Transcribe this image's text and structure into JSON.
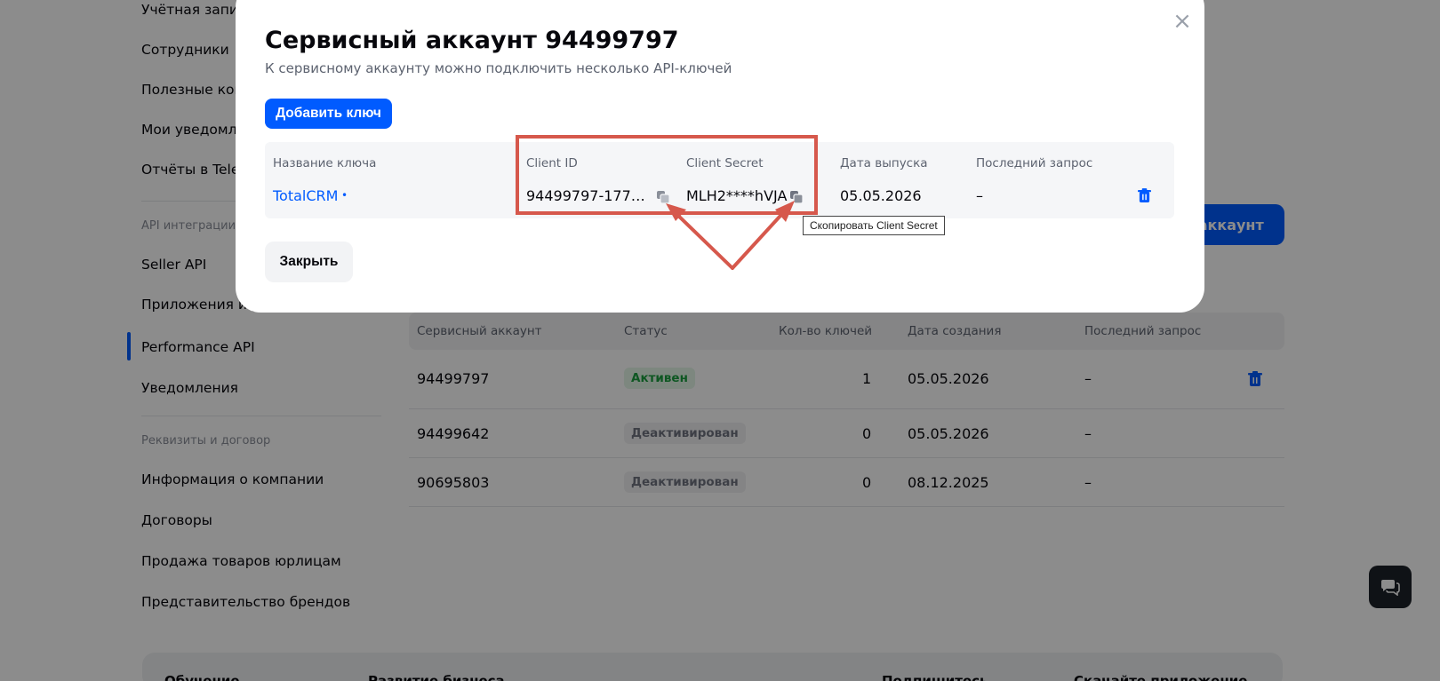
{
  "sidebar": {
    "items": [
      {
        "label": "Учётная запис"
      },
      {
        "label": "Сотрудники"
      },
      {
        "label": "Полезные кон"
      },
      {
        "label": "Мои уведомле"
      },
      {
        "label": "Отчёты в Teleg"
      }
    ],
    "api_section": "API интеграции",
    "api_items": [
      {
        "label": "Seller API"
      },
      {
        "label": "Приложения и р"
      },
      {
        "label": "Performance API",
        "active": true
      },
      {
        "label": "Уведомления"
      }
    ],
    "requisites_section": "Реквизиты и договор",
    "requisites_items": [
      {
        "label": "Информация о компании"
      },
      {
        "label": "Договоры"
      },
      {
        "label": "Продажа товаров юрлицам"
      },
      {
        "label": "Представительство брендов"
      }
    ]
  },
  "background": {
    "create_button": "ь аккаунт",
    "table": {
      "headers": [
        "Сервисный аккаунт",
        "Статус",
        "Кол-во ключей",
        "Дата создания",
        "Последний запрос"
      ],
      "rows": [
        {
          "account": "94499797",
          "status": "Активен",
          "keys": "1",
          "created": "05.05.2026",
          "last": "–"
        },
        {
          "account": "94499642",
          "status": "Деактивирован",
          "keys": "0",
          "created": "05.05.2026",
          "last": "–"
        },
        {
          "account": "90695803",
          "status": "Деактивирован",
          "keys": "0",
          "created": "08.12.2025",
          "last": "–"
        }
      ]
    },
    "footer": [
      "Обучение",
      "Развитие бизнеса",
      "Подпишитесь",
      "Скачайте приложение"
    ]
  },
  "modal": {
    "title": "Сервисный аккаунт 94499797",
    "subtitle": "К сервисному аккаунту можно подключить несколько API-ключей",
    "add_key_label": "Добавить ключ",
    "close_icon": "×",
    "table": {
      "headers": {
        "name": "Название ключа",
        "client_id": "Client ID",
        "client_secret": "Client Secret",
        "issued": "Дата выпуска",
        "last_request": "Последний запрос"
      },
      "row": {
        "name": "TotalCRM",
        "dot": "•",
        "client_id": "94499797-177…",
        "client_secret": "MLH2****hVJA",
        "issued": "05.05.2026",
        "last_request": "–"
      }
    },
    "close_label": "Закрыть"
  },
  "tooltip": "Скопировать Client Secret",
  "colors": {
    "accent": "#005bff",
    "annotation": "#d6584c",
    "active_status": "#1a9e3f"
  },
  "icons": [
    "close-icon",
    "copy-icon",
    "trash-icon",
    "chat-icon"
  ]
}
